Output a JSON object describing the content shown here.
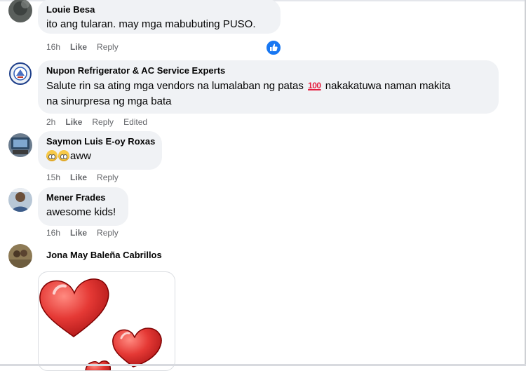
{
  "comments": [
    {
      "author": "Louie Besa",
      "text": "ito ang tularan. may mga mabubuting PUSO.",
      "time": "16h",
      "like": "Like",
      "reply": "Reply",
      "reaction": "like-icon"
    },
    {
      "author": "Nupon Refrigerator & AC Service Experts",
      "text_line1_before": "Salute rin sa ating mga vendors na lumalaban ng patas ",
      "text_emoji": "100",
      "text_line1_after": " nakakatuwa naman makita",
      "text_line2": "na sinurpresa ng mga bata",
      "time": "2h",
      "like": "Like",
      "reply": "Reply",
      "edited": "Edited"
    },
    {
      "author": "Saymon Luis E-oy Roxas",
      "text": "aww",
      "time": "15h",
      "like": "Like",
      "reply": "Reply"
    },
    {
      "author": "Mener Frades",
      "text": "awesome kids!",
      "time": "16h",
      "like": "Like",
      "reply": "Reply"
    },
    {
      "author": "Jona May Baleña Cabrillos",
      "sticker": "hearts-sticker"
    }
  ],
  "colors": {
    "bubble": "#f0f2f5",
    "meta": "#65676b",
    "like_blue": "#1877f2",
    "heart_red": "#e53935"
  }
}
